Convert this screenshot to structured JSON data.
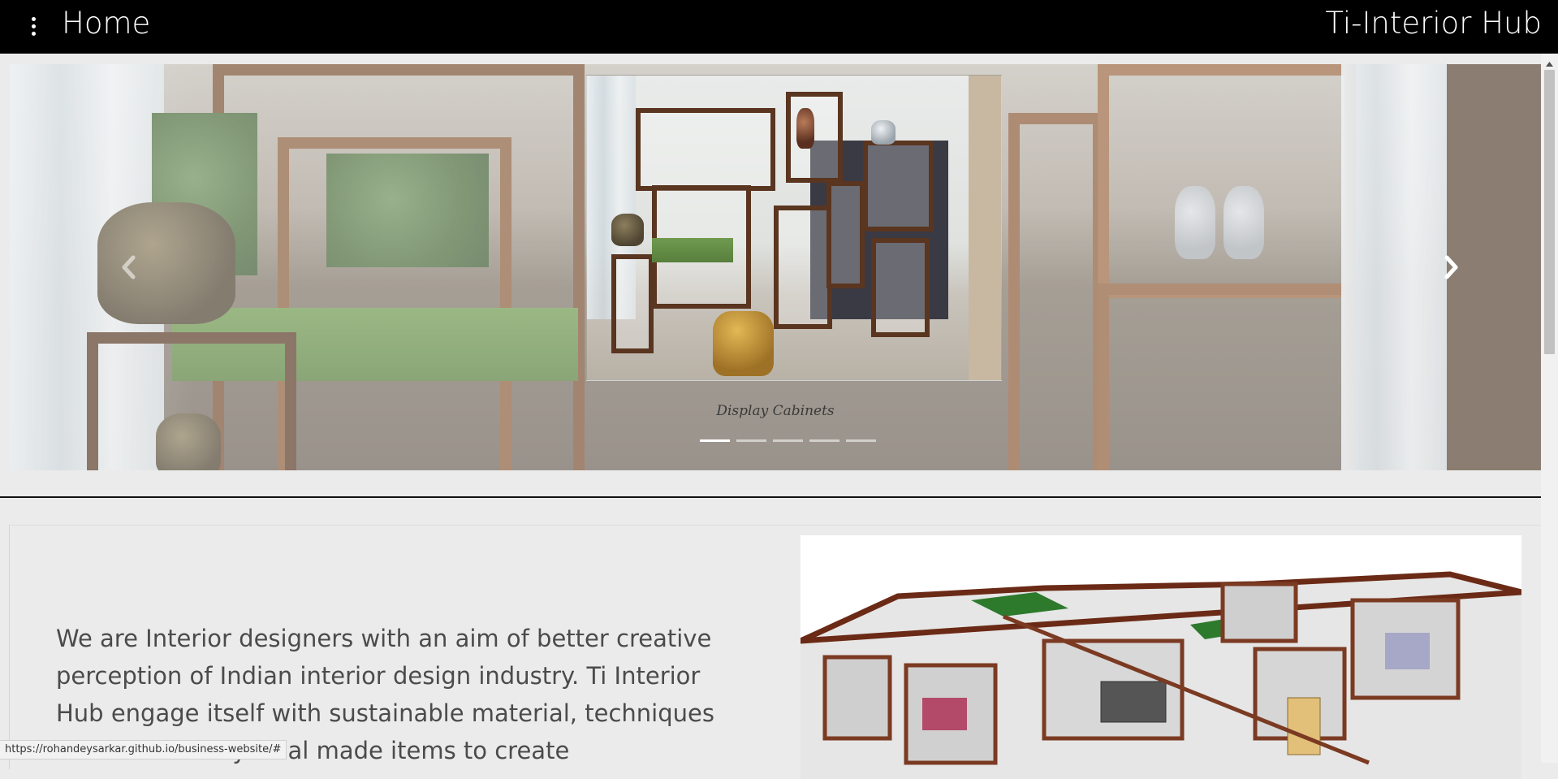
{
  "header": {
    "menu_icon": "vertical-dots-icon",
    "title": "Home",
    "brand": "Ti-Interior Hub"
  },
  "carousel": {
    "caption": "Display Cabinets",
    "slides_count": 5,
    "active_index": 0,
    "prev_icon": "chevron-left-icon",
    "next_icon": "chevron-right-icon"
  },
  "about": {
    "text": "We are Interior designers with an aim of better creative perception of Indian interior design industry. Ti Interior Hub engage itself with sustainable material, techniques and eco friendly local made items to create"
  },
  "status_bar": {
    "url": "https://rohandeysarkar.github.io/business-website/#"
  },
  "colors": {
    "topbar": "#000000",
    "page_background": "#ebebeb",
    "body_text": "#4b4b4b"
  }
}
